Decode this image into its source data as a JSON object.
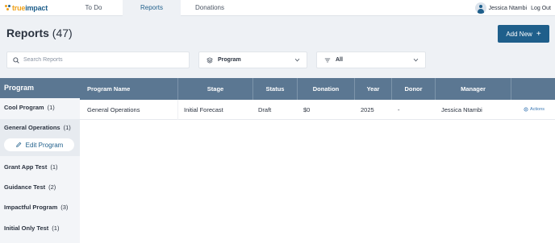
{
  "brand": {
    "logo_part1": "true",
    "logo_part2": "impact"
  },
  "nav": {
    "tabs": [
      {
        "label": "To Do",
        "active": false
      },
      {
        "label": "Reports",
        "active": true
      },
      {
        "label": "Donations",
        "active": false
      }
    ],
    "user_name": "Jessica Ntambi",
    "logout_label": "Log Out"
  },
  "header": {
    "title": "Reports",
    "count": "(47)",
    "add_label": "Add New"
  },
  "filters": {
    "search_placeholder": "Search Reports",
    "group_by_value": "Program",
    "filter_value": "All"
  },
  "sidebar": {
    "heading": "Program",
    "items": [
      {
        "label": "Cool Program",
        "count": "(1)"
      },
      {
        "label": "General Operations",
        "count": "(1)"
      },
      {
        "label": "Grant App Test",
        "count": "(1)"
      },
      {
        "label": "Guidance Test",
        "count": "(2)"
      },
      {
        "label": "Impactful Program",
        "count": "(3)"
      },
      {
        "label": "Initial Only Test",
        "count": "(1)"
      }
    ],
    "edit_label": "Edit Program"
  },
  "table": {
    "columns": [
      "Program Name",
      "Stage",
      "Status",
      "Donation",
      "Year",
      "Donor",
      "Manager"
    ],
    "rows": [
      {
        "program_name": "General Operations",
        "stage": "Initial Forecast",
        "status": "Draft",
        "donation": "$0",
        "year": "2025",
        "donor": "-",
        "manager": "Jessica Ntambi",
        "actions_label": "Actions"
      }
    ]
  },
  "colors": {
    "primary": "#1f5f8b",
    "table_header": "#5b7792",
    "accent": "#f0a21b"
  }
}
